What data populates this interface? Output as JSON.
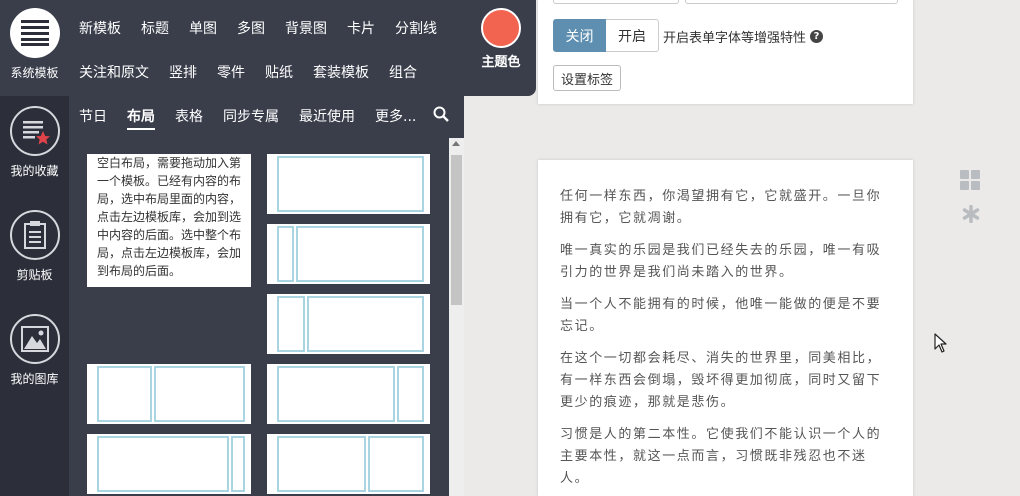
{
  "rail": {
    "items": [
      {
        "label": "系统模板",
        "icon": "template-icon"
      },
      {
        "label": "我的收藏",
        "icon": "favorites-icon"
      },
      {
        "label": "剪贴板",
        "icon": "clipboard-icon"
      },
      {
        "label": "我的图库",
        "icon": "gallery-icon"
      }
    ]
  },
  "topmenu": {
    "row1": [
      "新模板",
      "标题",
      "单图",
      "多图",
      "背景图",
      "卡片",
      "分割线"
    ],
    "row2": [
      "关注和原文",
      "竖排",
      "零件",
      "贴纸",
      "套装模板",
      "组合"
    ],
    "theme_label": "主题色",
    "theme_color": "#f26450"
  },
  "subtabs": {
    "items": [
      "节日",
      "布局",
      "表格",
      "同步专属",
      "最近使用",
      "更多..."
    ],
    "active": "布局"
  },
  "panel": {
    "blank_note": "空白布局，需要拖动加入第一个模板。已经有内容的布局，选中布局里面的内容，点击左边模板库，会加到选中内容的后面。选中整个布局，点击左边模板库，会加到布局的后面。"
  },
  "settings": {
    "close_label": "关闭",
    "open_label": "开启",
    "description": "开启表单字体等增强特性",
    "set_label_button": "设置标签"
  },
  "article": {
    "paragraphs": [
      "任何一样东西，你渴望拥有它，它就盛开。一旦你拥有它，它就凋谢。",
      "唯一真实的乐园是我们已经失去的乐园，唯一有吸引力的世界是我们尚未踏入的世界。",
      "当一个人不能拥有的时候，他唯一能做的便是不要忘记。",
      "在这个一切都会耗尽、消失的世界里，同美相比，有一样东西会倒塌，毁坏得更加彻底，同时又留下更少的痕迹，那就是悲伤。",
      "习惯是人的第二本性。它使我们不能认识一个人的主要本性，就这一点而言，习惯既非残忍也不迷人。"
    ]
  }
}
